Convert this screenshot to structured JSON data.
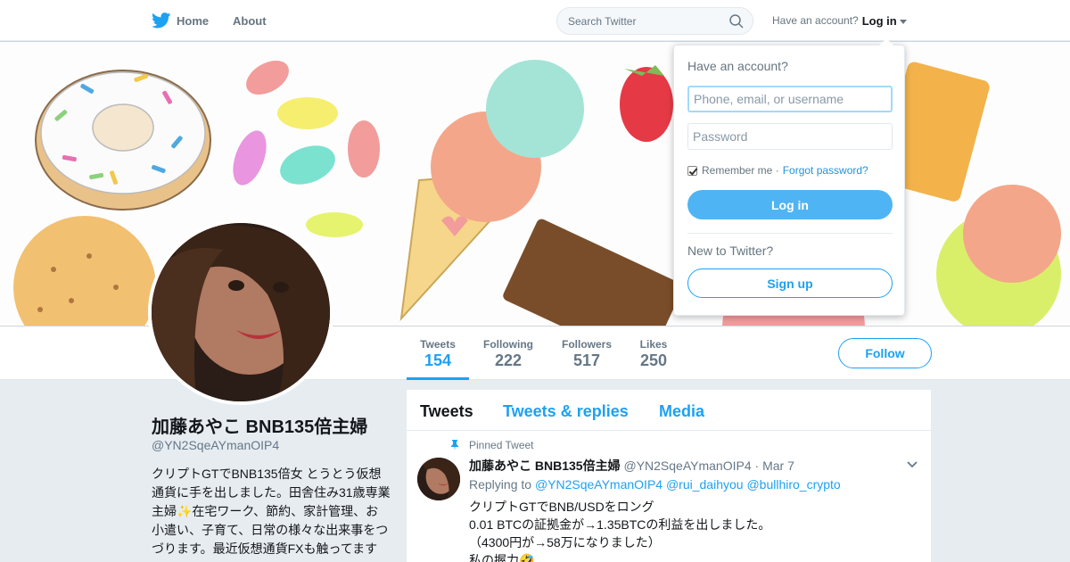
{
  "nav": {
    "home_label": "Home",
    "about_label": "About",
    "search_placeholder": "Search Twitter",
    "account_prompt": "Have an account?",
    "login_label": "Log in"
  },
  "profile": {
    "name": "加藤あやこ BNB135倍主婦",
    "handle": "@YN2SqeAYmanOIP4",
    "bio": "クリプトGTでBNB135倍女 とうとう仮想通貨に手を出しました。田舎住み31歳専業主婦✨在宅ワーク、節約、家計管理、お小遣い、子育て、日常の様々な出来事をつづります。最近仮想通貨FXも触ってます"
  },
  "stats": [
    {
      "label": "Tweets",
      "value": "154"
    },
    {
      "label": "Following",
      "value": "222"
    },
    {
      "label": "Followers",
      "value": "517"
    },
    {
      "label": "Likes",
      "value": "250"
    }
  ],
  "follow_label": "Follow",
  "timeline": {
    "tabs": [
      "Tweets",
      "Tweets & replies",
      "Media"
    ],
    "pinned_label": "Pinned Tweet",
    "tweet": {
      "name": "加藤あやこ BNB135倍主婦",
      "handle": "@YN2SqeAYmanOIP4",
      "date": "· Mar 7",
      "replying_to": "Replying to",
      "mentions": "@YN2SqeAYmanOIP4 @rui_daihyou @bullhiro_crypto",
      "lines": [
        "クリプトGTでBNB/USDをロング",
        "0.01 BTCの証拠金が→1.35BTCの利益を出しました。",
        "（4300円が→58万になりました）",
        "私の握力🤣"
      ]
    }
  },
  "login_dropdown": {
    "heading": "Have an account?",
    "username_placeholder": "Phone, email, or username",
    "password_placeholder": "Password",
    "remember_label": "Remember me ·",
    "forgot_label": "Forgot password?",
    "login_button": "Log in",
    "new_label": "New to Twitter?",
    "signup_button": "Sign up"
  },
  "colors": {
    "accent": "#1da1f2",
    "background": "#e6ecf0"
  }
}
